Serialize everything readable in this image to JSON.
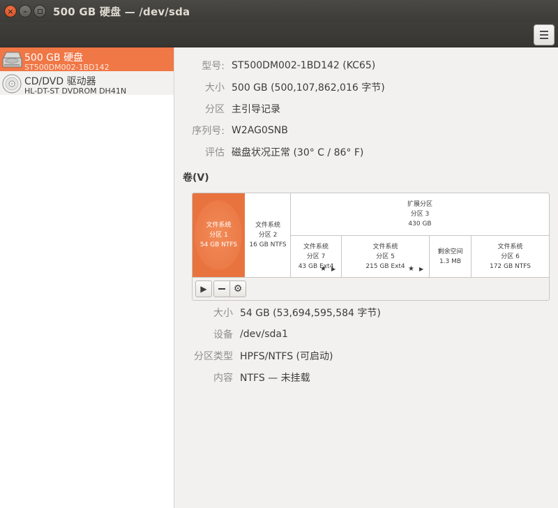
{
  "window": {
    "title": "500 GB 硬盘 — /dev/sda"
  },
  "sidebar": {
    "drives": [
      {
        "name": "500 GB 硬盘",
        "model": "ST500DM002-1BD142",
        "selected": true,
        "icon": "hard-disk-icon"
      },
      {
        "name": "CD/DVD 驱动器",
        "model": "HL-DT-ST DVDROM DH41N",
        "selected": false,
        "icon": "optical-disc-icon"
      }
    ]
  },
  "disk_info": {
    "model_label": "型号:",
    "model_value": "ST500DM002-1BD142 (KC65)",
    "size_label": "大小",
    "size_value": "500 GB (500,107,862,016 字节)",
    "partitioning_label": "分区",
    "partitioning_value": "主引导记录",
    "serial_label": "序列号:",
    "serial_value": "W2AG0SNB",
    "assessment_label": "评估",
    "assessment_value": "磁盘状况正常 (30° C / 86° F)"
  },
  "volumes": {
    "title": "卷(V)",
    "partition1": {
      "line1": "文件系统",
      "line2": "分区 1",
      "line3": "54 GB NTFS"
    },
    "partition2": {
      "line1": "文件系统",
      "line2": "分区 2",
      "line3": "16 GB NTFS"
    },
    "extended": {
      "line1": "扩展分区",
      "line2": "分区 3",
      "line3": "430 GB"
    },
    "partition7": {
      "line1": "文件系统",
      "line2": "分区 7",
      "line3": "43 GB Ext4"
    },
    "partition5": {
      "line1": "文件系统",
      "line2": "分区 5",
      "line3": "215 GB Ext4"
    },
    "free": {
      "line1": "剩余空间",
      "line2": "1.3 MB"
    },
    "partition6": {
      "line1": "文件系统",
      "line2": "分区 6",
      "line3": "172 GB NTFS"
    }
  },
  "partition_details": {
    "size_label": "大小",
    "size_value": "54 GB (53,694,595,584 字节)",
    "device_label": "设备",
    "device_value": "/dev/sda1",
    "type_label": "分区类型",
    "type_value": "HPFS/NTFS (可启动)",
    "contents_label": "内容",
    "contents_value": "NTFS — 未挂载"
  },
  "colors": {
    "accent": "#e8733f",
    "selected_row": "#f07746",
    "titlebar": "#3c3b37"
  }
}
